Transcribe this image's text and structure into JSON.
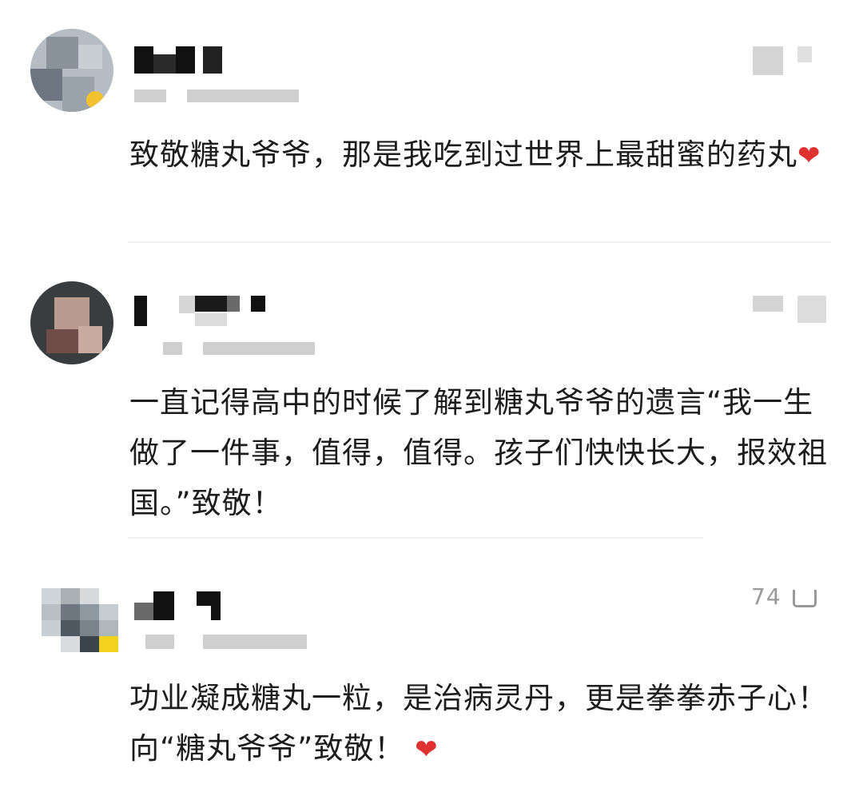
{
  "comments": [
    {
      "text": "致敬糖丸爷爷，那是我吃到过世界上最甜蜜的药丸",
      "emoji": "❤",
      "heart_color": "#e03131"
    },
    {
      "text": "一直记得高中的时候了解到糖丸爷爷的遗言“我一生做了一件事，值得，值得。孩子们快快长大，报效祖国。”致敬！"
    },
    {
      "text": "功业凝成糖丸一粒，是治病灵丹，更是拳拳赤子心！向“糖丸爷爷”致敬！",
      "emoji": "❤",
      "heart_color": "#e03131",
      "like_count": "74"
    }
  ],
  "icons": {
    "heart": "heart-emoji",
    "like": "thumb-up-icon"
  }
}
